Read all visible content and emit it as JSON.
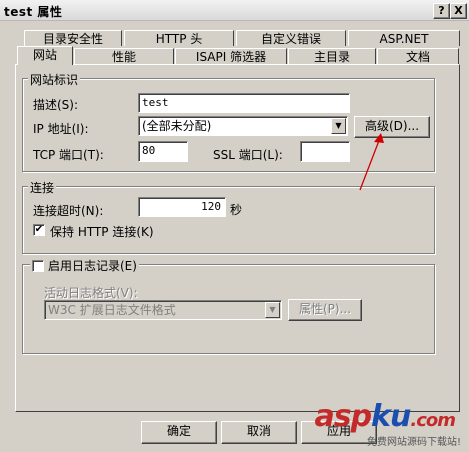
{
  "window": {
    "title": "test 属性",
    "help_btn": "?",
    "close_btn": "X"
  },
  "tabs_top": [
    "目录安全性",
    "HTTP 头",
    "自定义错误",
    "ASP.NET"
  ],
  "tabs_bottom": [
    "网站",
    "性能",
    "ISAPI 筛选器",
    "主目录",
    "文档"
  ],
  "website_id": {
    "group_label": "网站标识",
    "desc_label": "描述(S):",
    "desc_value": "test",
    "ip_label": "IP 地址(I):",
    "ip_value": "(全部未分配)",
    "advanced_btn": "高级(D)...",
    "tcp_label": "TCP 端口(T):",
    "tcp_value": "80",
    "ssl_label": "SSL 端口(L):",
    "ssl_value": ""
  },
  "connection": {
    "group_label": "连接",
    "timeout_label": "连接超时(N):",
    "timeout_value": "120",
    "timeout_unit": "秒",
    "keepalive_label": "保持 HTTP 连接(K)",
    "keepalive_checked": true
  },
  "logging": {
    "enable_label": "启用日志记录(E)",
    "enabled": false,
    "format_label": "活动日志格式(V):",
    "format_value": "W3C 扩展日志文件格式",
    "properties_btn": "属性(P)..."
  },
  "footer": {
    "ok": "确定",
    "cancel": "取消",
    "apply": "应用"
  },
  "watermark": {
    "brand_red1": "asp",
    "brand_blue": "ku",
    "brand_red2": ".com",
    "sub": "免费网站源码下载站!"
  }
}
